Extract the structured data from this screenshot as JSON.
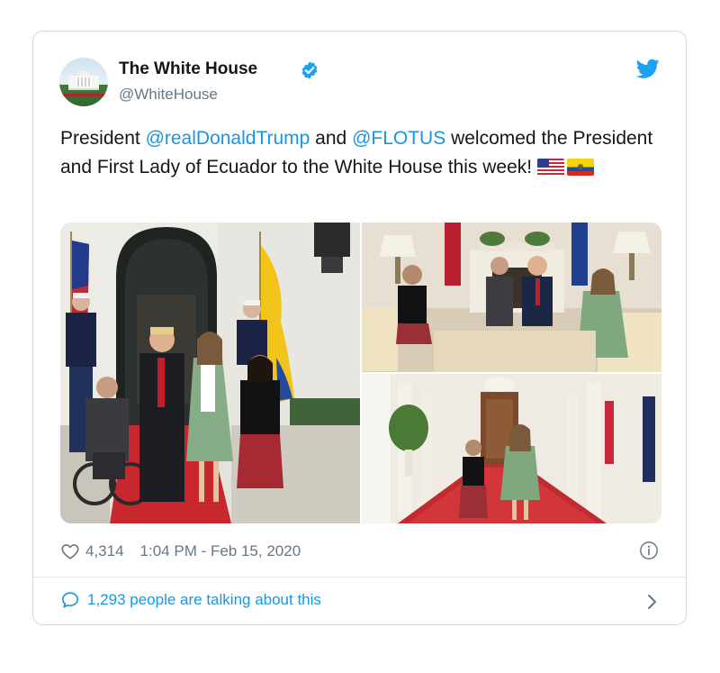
{
  "tweet": {
    "author_name": "The White House",
    "author_handle": "@WhiteHouse",
    "text_parts": {
      "p1": "President ",
      "m1": "@realDonaldTrump",
      "p2": " and ",
      "m2": "@FLOTUS",
      "p3": " welcomed the President and First Lady of Ecuador to the White House this week! "
    },
    "likes": "4,314",
    "timestamp": "1:04 PM - Feb 15, 2020",
    "talking": "1,293 people are talking about this"
  },
  "icons": {
    "verified": "verified-badge-icon",
    "bird": "twitter-bird-icon",
    "heart": "heart-icon",
    "info": "info-icon",
    "bubble": "speech-bubble-icon",
    "chevron": "chevron-right-icon",
    "flag_us": "us-flag-icon",
    "flag_ec": "ecuador-flag-icon"
  },
  "colors": {
    "link": "#1b95e0",
    "meta": "#657786",
    "text": "#14171a",
    "border": "#cfd9de"
  }
}
